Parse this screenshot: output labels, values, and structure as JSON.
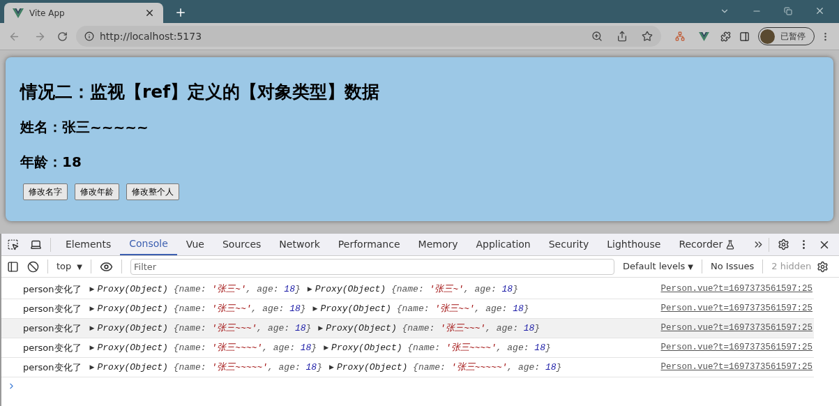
{
  "browser": {
    "tab_title": "Vite App",
    "url": "http://localhost:5173",
    "profile_label": "已暂停"
  },
  "page": {
    "heading": "情况二：监视【ref】定义的【对象类型】数据",
    "name_line": "姓名：张三~~~~~",
    "age_line": "年龄：18",
    "buttons": [
      "修改名字",
      "修改年龄",
      "修改整个人"
    ]
  },
  "devtools": {
    "tabs": [
      {
        "label": "Elements",
        "selected": false
      },
      {
        "label": "Console",
        "selected": true
      },
      {
        "label": "Vue",
        "selected": false
      },
      {
        "label": "Sources",
        "selected": false
      },
      {
        "label": "Network",
        "selected": false
      },
      {
        "label": "Performance",
        "selected": false
      },
      {
        "label": "Memory",
        "selected": false
      },
      {
        "label": "Application",
        "selected": false
      },
      {
        "label": "Security",
        "selected": false
      },
      {
        "label": "Lighthouse",
        "selected": false
      },
      {
        "label": "Recorder",
        "selected": false
      }
    ],
    "context": "top",
    "context_arrow": "▼",
    "filter_placeholder": "Filter",
    "levels": "Default levels",
    "levels_arrow": "▼",
    "issues": "No Issues",
    "hidden": "2 hidden",
    "rows": [
      {
        "message": "person变化了",
        "highlighted": false,
        "objects": [
          {
            "expander": "▶",
            "type": "Proxy(Object)",
            "tokens": [
              {
                "kind": "punct",
                "text": "{name: "
              },
              {
                "kind": "string",
                "text": "'张三~'"
              },
              {
                "kind": "punct",
                "text": ", age: "
              },
              {
                "kind": "number",
                "text": "18"
              },
              {
                "kind": "punct",
                "text": "}"
              }
            ]
          },
          {
            "expander": "▶",
            "type": "Proxy(Object)",
            "tokens": [
              {
                "kind": "punct",
                "text": "{name: "
              },
              {
                "kind": "string",
                "text": "'张三~'"
              },
              {
                "kind": "punct",
                "text": ", age: "
              },
              {
                "kind": "number",
                "text": "18"
              },
              {
                "kind": "punct",
                "text": "}"
              }
            ]
          }
        ],
        "source": "Person.vue?t=1697373561597:25"
      },
      {
        "message": "person变化了",
        "highlighted": false,
        "objects": [
          {
            "expander": "▶",
            "type": "Proxy(Object)",
            "tokens": [
              {
                "kind": "punct",
                "text": "{name: "
              },
              {
                "kind": "string",
                "text": "'张三~~'"
              },
              {
                "kind": "punct",
                "text": ", age: "
              },
              {
                "kind": "number",
                "text": "18"
              },
              {
                "kind": "punct",
                "text": "}"
              }
            ]
          },
          {
            "expander": "▶",
            "type": "Proxy(Object)",
            "tokens": [
              {
                "kind": "punct",
                "text": "{name: "
              },
              {
                "kind": "string",
                "text": "'张三~~'"
              },
              {
                "kind": "punct",
                "text": ", age: "
              },
              {
                "kind": "number",
                "text": "18"
              },
              {
                "kind": "punct",
                "text": "}"
              }
            ]
          }
        ],
        "source": "Person.vue?t=1697373561597:25"
      },
      {
        "message": "person变化了",
        "highlighted": true,
        "objects": [
          {
            "expander": "▶",
            "type": "Proxy(Object)",
            "tokens": [
              {
                "kind": "punct",
                "text": "{name: "
              },
              {
                "kind": "string",
                "text": "'张三~~~'"
              },
              {
                "kind": "punct",
                "text": ", age: "
              },
              {
                "kind": "number",
                "text": "18"
              },
              {
                "kind": "punct",
                "text": "}"
              }
            ]
          },
          {
            "expander": "▶",
            "type": "Proxy(Object)",
            "tokens": [
              {
                "kind": "punct",
                "text": "{name: "
              },
              {
                "kind": "string",
                "text": "'张三~~~'"
              },
              {
                "kind": "punct",
                "text": ", age: "
              },
              {
                "kind": "number",
                "text": "18"
              },
              {
                "kind": "punct",
                "text": "}"
              }
            ]
          }
        ],
        "source": "Person.vue?t=1697373561597:25"
      },
      {
        "message": "person变化了",
        "highlighted": false,
        "objects": [
          {
            "expander": "▶",
            "type": "Proxy(Object)",
            "tokens": [
              {
                "kind": "punct",
                "text": "{name: "
              },
              {
                "kind": "string",
                "text": "'张三~~~~'"
              },
              {
                "kind": "punct",
                "text": ", age: "
              },
              {
                "kind": "number",
                "text": "18"
              },
              {
                "kind": "punct",
                "text": "}"
              }
            ]
          },
          {
            "expander": "▶",
            "type": "Proxy(Object)",
            "tokens": [
              {
                "kind": "punct",
                "text": "{name: "
              },
              {
                "kind": "string",
                "text": "'张三~~~~'"
              },
              {
                "kind": "punct",
                "text": ", age: "
              },
              {
                "kind": "number",
                "text": "18"
              },
              {
                "kind": "punct",
                "text": "}"
              }
            ]
          }
        ],
        "source": "Person.vue?t=1697373561597:25"
      },
      {
        "message": "person变化了",
        "highlighted": false,
        "objects": [
          {
            "expander": "▶",
            "type": "Proxy(Object)",
            "tokens": [
              {
                "kind": "punct",
                "text": "{name: "
              },
              {
                "kind": "string",
                "text": "'张三~~~~~'"
              },
              {
                "kind": "punct",
                "text": ", age: "
              },
              {
                "kind": "number",
                "text": "18"
              },
              {
                "kind": "punct",
                "text": "}"
              }
            ]
          },
          {
            "expander": "▶",
            "type": "Proxy(Object)",
            "tokens": [
              {
                "kind": "punct",
                "text": "{name: "
              },
              {
                "kind": "string",
                "text": "'张三~~~~~'"
              },
              {
                "kind": "punct",
                "text": ", age: "
              },
              {
                "kind": "number",
                "text": "18"
              },
              {
                "kind": "punct",
                "text": "}"
              }
            ]
          }
        ],
        "source": "Person.vue?t=1697373561597:25"
      }
    ]
  }
}
